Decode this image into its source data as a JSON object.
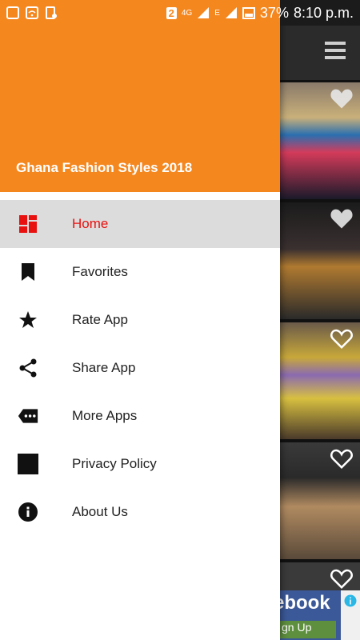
{
  "status_bar": {
    "sim_badge": "2",
    "network_type": "4G",
    "roaming": "E",
    "battery_percent": "37%",
    "time": "8:10 p.m."
  },
  "drawer": {
    "title": "Ghana Fashion Styles 2018",
    "header_color": "#f5871f",
    "active_color": "#e8110f",
    "items": [
      {
        "label": "Home",
        "icon": "dashboard-icon",
        "active": true
      },
      {
        "label": "Favorites",
        "icon": "bookmark-icon",
        "active": false
      },
      {
        "label": "Rate App",
        "icon": "star-icon",
        "active": false
      },
      {
        "label": "Share App",
        "icon": "share-icon",
        "active": false
      },
      {
        "label": "More Apps",
        "icon": "more-apps-icon",
        "active": false
      },
      {
        "label": "Privacy Policy",
        "icon": "privacy-square-icon",
        "active": false
      },
      {
        "label": "About Us",
        "icon": "info-icon",
        "active": false
      }
    ]
  },
  "background": {
    "ad_text": "ebook",
    "ad_button": "gn Up"
  }
}
